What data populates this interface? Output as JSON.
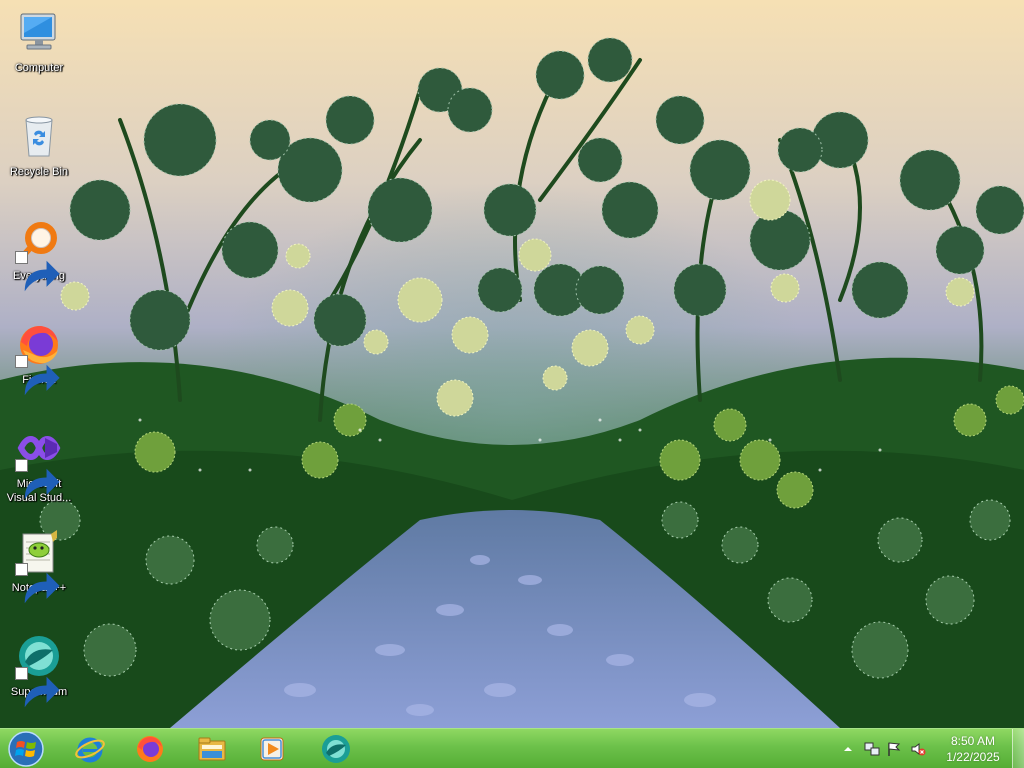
{
  "desktop": {
    "icons": [
      {
        "label": "Computer",
        "icon": "computer-icon",
        "shortcut": false
      },
      {
        "label": "Recycle Bin",
        "icon": "recycle-bin-icon",
        "shortcut": false
      },
      {
        "label": "Everything",
        "icon": "everything-icon",
        "shortcut": true
      },
      {
        "label": "Firefox",
        "icon": "firefox-icon",
        "shortcut": true
      },
      {
        "label": "Microsoft\nVisual Stud...",
        "icon": "visual-studio-icon",
        "shortcut": true
      },
      {
        "label": "Notepad++",
        "icon": "notepad-plus-plus-icon",
        "shortcut": true
      },
      {
        "label": "Supermium",
        "icon": "supermium-icon",
        "shortcut": true
      }
    ]
  },
  "taskbar": {
    "pinned": [
      {
        "icon": "internet-explorer-icon"
      },
      {
        "icon": "firefox-icon"
      },
      {
        "icon": "file-explorer-icon"
      },
      {
        "icon": "media-player-icon"
      },
      {
        "icon": "supermium-icon"
      }
    ],
    "tray": {
      "icons": [
        "show-hidden-icons-arrow",
        "network-icon",
        "action-center-flag-icon",
        "volume-muted-icon"
      ],
      "time": "8:50 AM",
      "date": "1/22/2025"
    },
    "colors": {
      "taskbar_top": "#8fd862",
      "taskbar_bottom": "#55ad35"
    }
  },
  "wallpaper": {
    "colors": {
      "sky_top": "#f5dfb5",
      "sky_mid": "#b9b2c8",
      "foliage": "#1d4f1f",
      "path": "#8a9bd0"
    }
  }
}
